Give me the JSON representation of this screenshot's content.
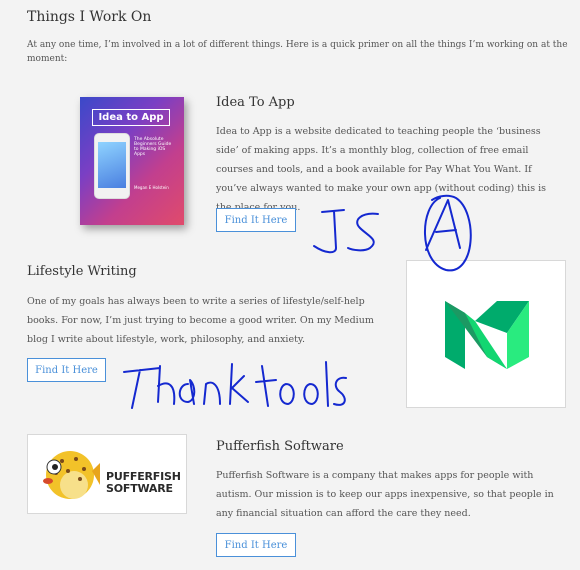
{
  "page": {
    "title": "Things I Work On",
    "intro": "At any one time, I’m involved in a lot of different things. Here is a quick primer on all the things I’m working on at the moment:"
  },
  "projects": [
    {
      "title": "Idea To App",
      "description": "Idea to App is a website dedicated to teaching people the ‘business side’ of making apps. It’s a monthly blog, collection of free email courses and tools, and a book available for Pay What You Want. If you’ve always wanted to make your own app (without coding) this is the place for you.",
      "button": "Find It Here",
      "book_title": "Idea to App",
      "book_subtitle": "The Absolute Beginners Guide to Making iOS Apps",
      "book_author": "Megan E Holstein"
    },
    {
      "title": "Lifestyle Writing",
      "description": "One of my goals has always been to write a series of lifestyle/self-help books. For now, I’m just trying to become a good writer. On my Medium blog I write about lifestyle, work, philosophy, and anxiety.",
      "button": "Find It Here",
      "logo_icon": "medium-logo-icon"
    },
    {
      "title": "Pufferfish Software",
      "description": "Pufferfish Software is a company that makes apps for people with autism. Our mission is to keep our apps inexpensive, so that people in any financial situation can afford the care they need.",
      "button": "Find It Here",
      "logo_line1": "PUFFERFISH",
      "logo_line2": "SOFTWARE"
    }
  ],
  "annotations": {
    "color": "#1428d0",
    "scribbles": [
      "JS",
      "A",
      "Thank tools"
    ]
  }
}
